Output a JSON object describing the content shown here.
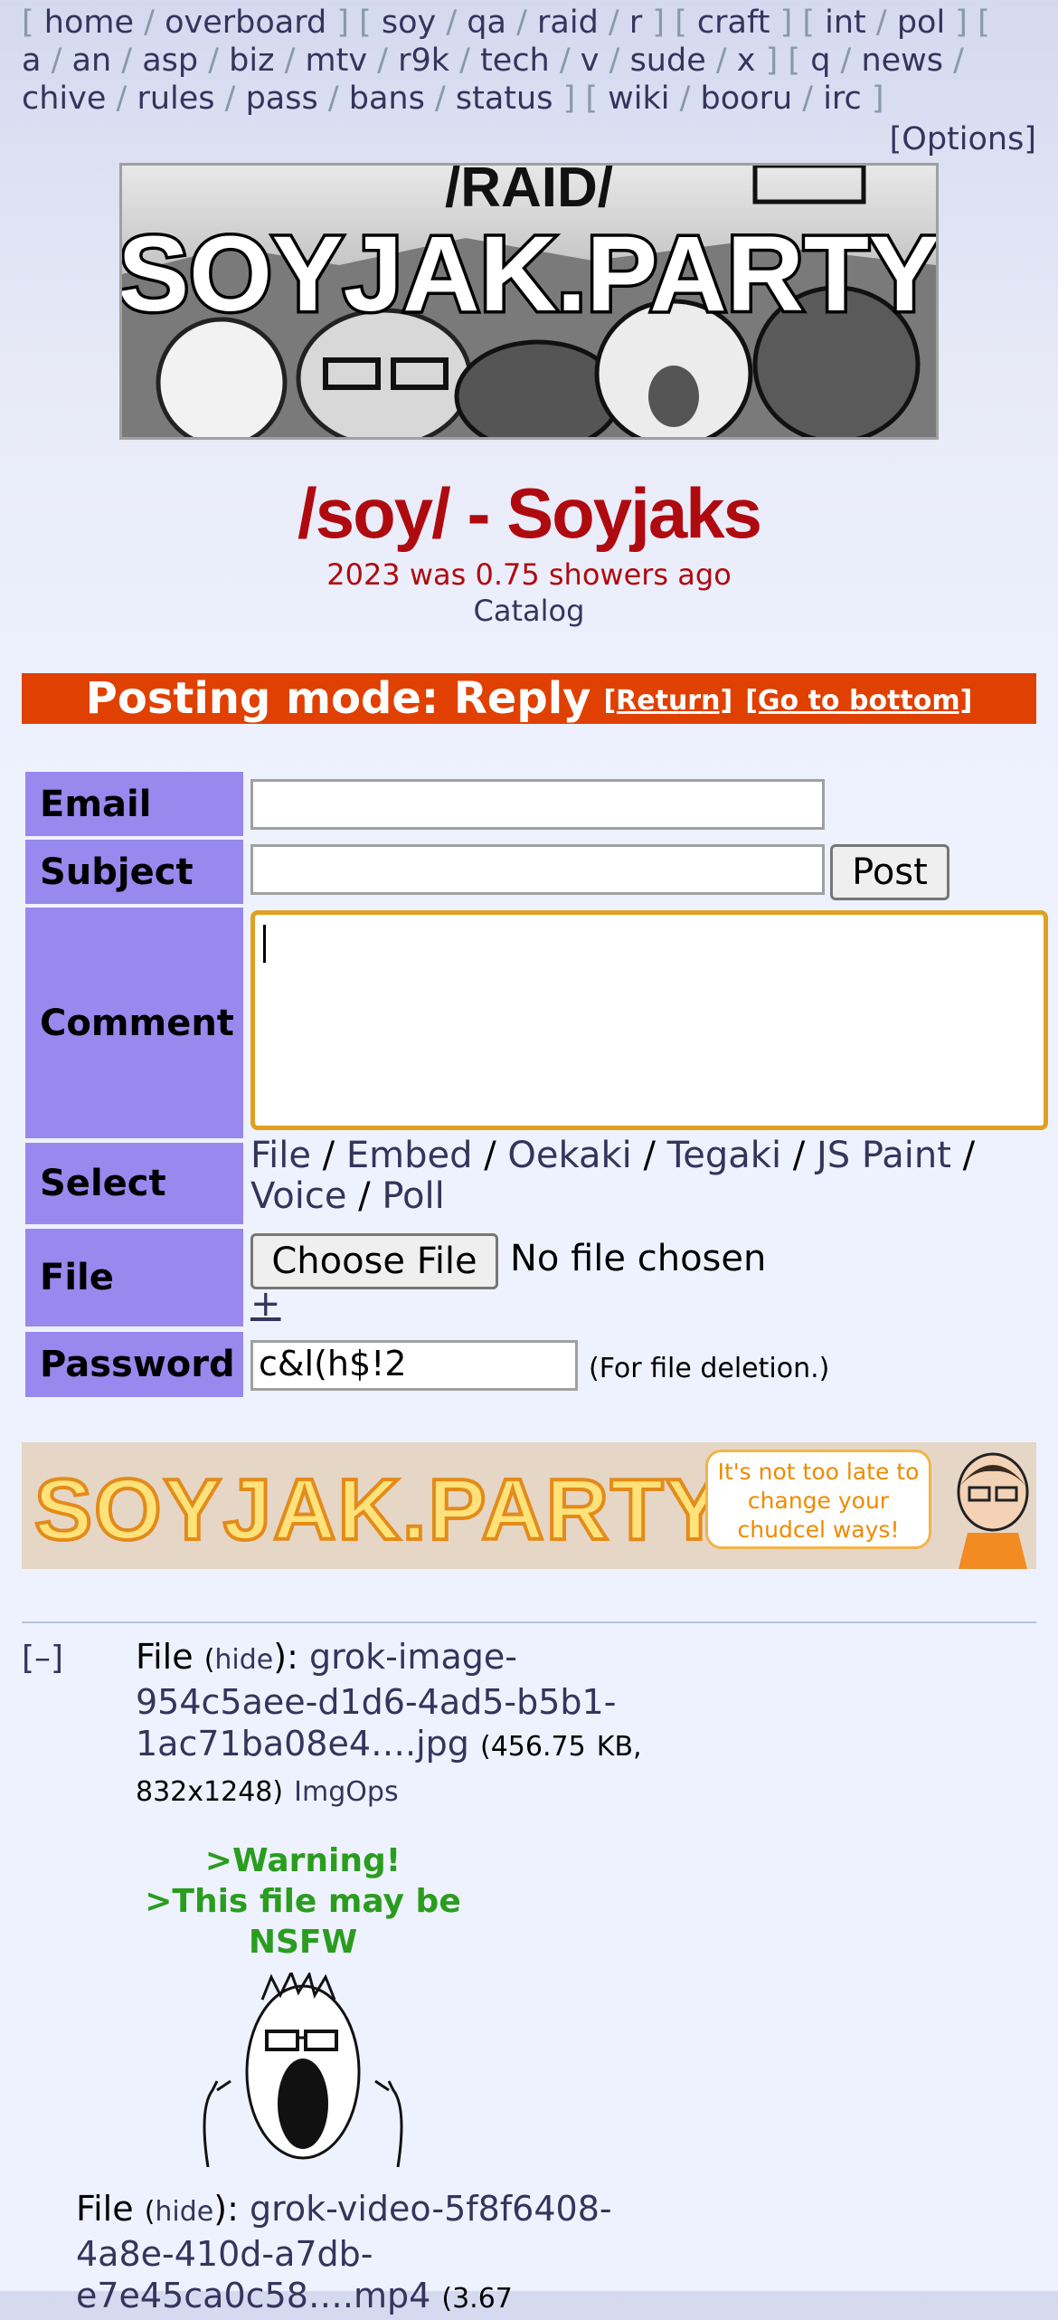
{
  "nav": {
    "groups": [
      [
        "home",
        "overboard"
      ],
      [
        "soy",
        "qa",
        "raid",
        "r"
      ],
      [
        "craft"
      ],
      [
        "int",
        "pol"
      ],
      [
        "a",
        "an",
        "asp",
        "biz",
        "mtv",
        "r9k",
        "tech",
        "v",
        "sude",
        "x"
      ],
      [
        "q",
        "news",
        "chive",
        "rules",
        "pass",
        "bans",
        "status"
      ],
      [
        "wiki",
        "booru",
        "irc"
      ]
    ],
    "options": "[Options]"
  },
  "banner": {
    "top_text": "/RAID/",
    "main_text": "SOYJAK.PARTY"
  },
  "board": {
    "title": "/soy/ - Soyjaks",
    "subtitle": "2023 was 0.75 showers ago",
    "catalog": "Catalog"
  },
  "posting_mode": {
    "label": "Posting mode: Reply",
    "return": "[Return]",
    "bottom": "[Go to bottom]"
  },
  "form": {
    "email_label": "Email",
    "subject_label": "Subject",
    "comment_label": "Comment",
    "select_label": "Select",
    "file_label": "File",
    "password_label": "Password",
    "post_button": "Post",
    "select_links": [
      "File",
      "Embed",
      "Oekaki",
      "Tegaki",
      "JS Paint",
      "Voice",
      "Poll"
    ],
    "choose_file": "Choose File",
    "no_file": "No file chosen",
    "add_file": "+",
    "password_value": "c&l(h$!2",
    "password_note": "(For file deletion.)"
  },
  "ad": {
    "text": "SOYJAK.PARTY/A",
    "bubble": "It's not too late to change your chudcel ways!"
  },
  "post": {
    "collapse": "[–]",
    "file1": {
      "prefix": "File",
      "hide": "hide",
      "name": "grok-image-954c5aee-d1d6-4ad5-b5b1-1ac71ba08e4….jpg",
      "dl_icon": "",
      "meta_a": "(456.75",
      "meta_b": "KB, 832x1248)",
      "imgops": "ImgOps"
    },
    "warning": [
      ">Warning!",
      ">This file may be",
      "NSFW"
    ],
    "file2": {
      "prefix": "File",
      "hide": "hide",
      "name": "grok-video-5f8f6408-4a8e-410d-a7db-e7e45ca0c58….mp4",
      "dl_icon": "",
      "meta_a": "(3.67"
    }
  },
  "colors": {
    "label_bg": "#9988ee",
    "posting_bar": "#e04000",
    "title": "#af0a0f",
    "warning": "#2a9d1f",
    "focus": "#e0a020"
  }
}
